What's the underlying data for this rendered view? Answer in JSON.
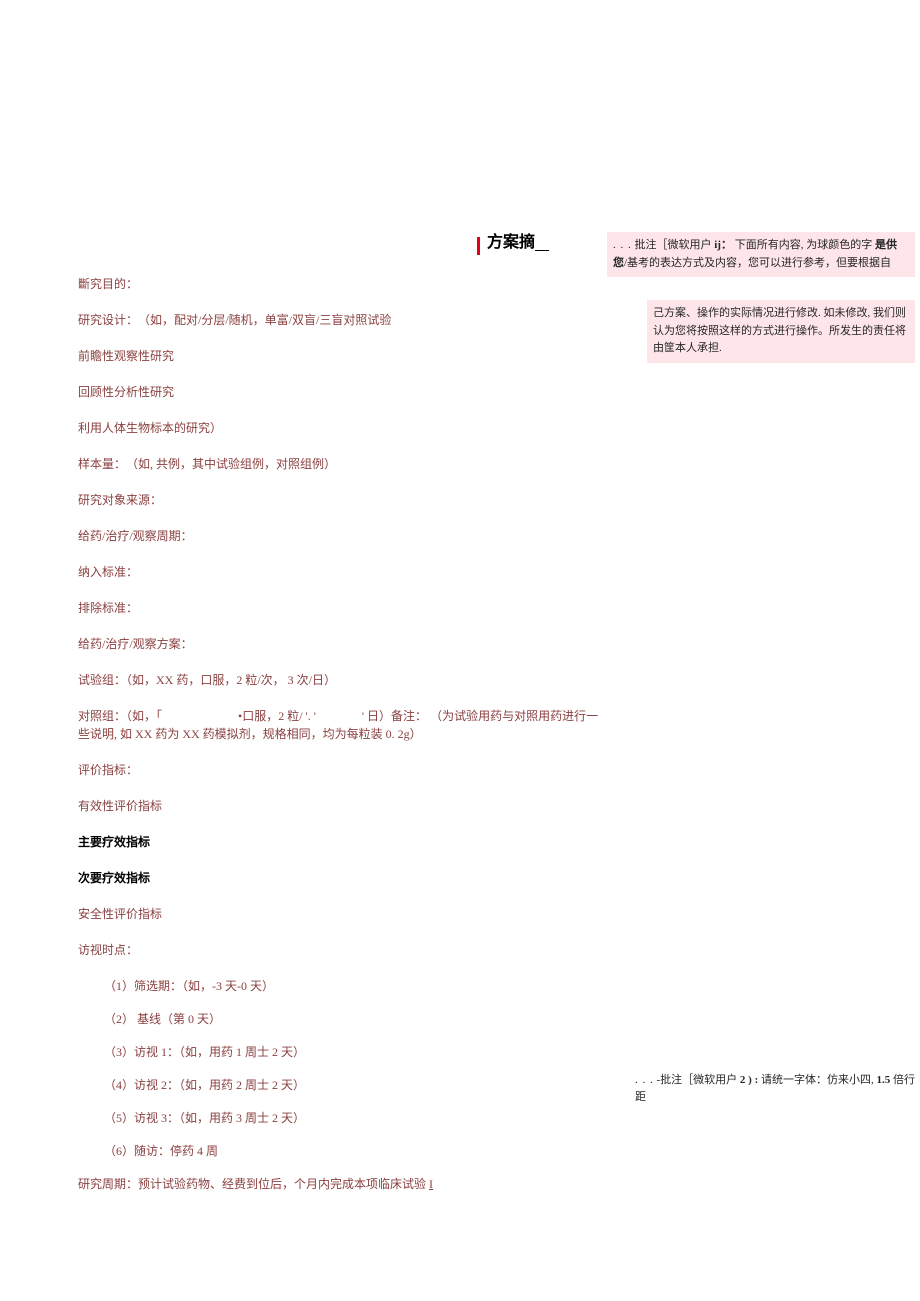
{
  "title": {
    "text": "方案摘"
  },
  "lines": {
    "purpose": "斷究目的：",
    "design": "研究设计：　（如，配对/分层/随机，单富/双盲/三盲对照试验",
    "prospective": "前瞻性观察性研究",
    "retrospective": "回顾性分析性研究",
    "biospecimen": "利用人体生物标本的研究）",
    "sample": "样本量：　（如, 共例，其中试验组例，对照组例）",
    "source": "研究对象来源：",
    "period": "给药/治疗/观察周期：",
    "inclusion": "纳入标准：",
    "exclusion": "排除标准：",
    "plan": "给药/治疗/观察方案：",
    "trial_group": "试验组：（如，XX 药，口服，2 粒/次， 3 次/日）",
    "control_group_prefix": "对照组：（如，「",
    "control_group_mid": "•口服，2 粒/ '. '",
    "control_group_end": "' 日）备注：",
    "control_group_note": "（为试验用药与对照用药进行一些说明, 如 XX 药为 XX 药模拟剂，规格相同，均为每粒装 0. 2g）",
    "eval": "评价指标：",
    "efficacy_eval": "有效性评价指标",
    "primary": "主要疗效指标",
    "secondary": "次要疗效指标",
    "safety_eval": "安全性评价指标",
    "visit_time": "访视时点：",
    "visit1": "（1）筛选期：（如，-3 天-0 天）",
    "visit2": "（2） 基线（第 0 天）",
    "visit3": "（3）访视 1：（如，用药 1 周士 2 天）",
    "visit4": "（4）访视 2：（如，用药 2 周士 2 天）",
    "visit5": "（5）访视 3：（如，用药 3 周士 2 天）",
    "visit6": "（6）随访：停药 4 周",
    "study_period_label": "研究周期：",
    "study_period_text": "预计试验药物、经费到位后，个月内完成本项临床试验",
    "study_period_end": "I"
  },
  "comment1": {
    "dots": ". . .",
    "label_prefix": "批注［微软用户",
    "label_bold": "ij：",
    "text1": "下面所有内容, 为球颜色的字",
    "text2_bold": "是供您",
    "text2": "/基考的表达方式及内容，您可以进行参考，但要根据自"
  },
  "comment1b": {
    "text1": "己方案、操作的实际情况进行修改. 如未修改, 我们则认为您将按照这样的方式进行操作。所发生的责任将由筐本人承担."
  },
  "comment2": {
    "dots": ". . .",
    "label": "-批注［微软用户",
    "label_bold": "2 ) :",
    "text": "请统一字体：仿来小四,",
    "text_bold": "1.5",
    "text_end": "倍行距"
  }
}
